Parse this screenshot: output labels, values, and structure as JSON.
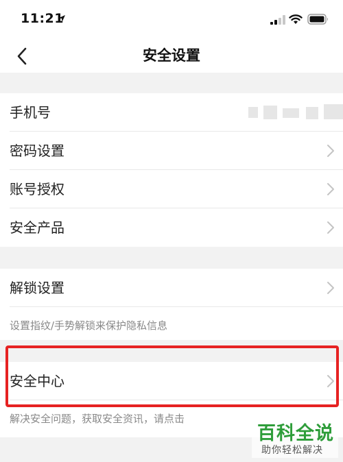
{
  "status_bar": {
    "time": "11:21"
  },
  "nav": {
    "title": "安全设置"
  },
  "groups": {
    "account": {
      "items": [
        {
          "label": "手机号"
        },
        {
          "label": "密码设置"
        },
        {
          "label": "账号授权"
        },
        {
          "label": "安全产品"
        }
      ]
    },
    "unlock": {
      "label": "解锁设置",
      "hint": "设置指纹/手势解锁来保护隐私信息"
    },
    "center": {
      "label": "安全中心",
      "hint": "解决安全问题，获取安全资讯，请点击"
    }
  },
  "watermark": {
    "title": "百科全说",
    "subtitle": "助你轻松解决"
  },
  "colors": {
    "highlight": "#e62222",
    "watermark": "#2e9d3a"
  },
  "icons": [
    "location-arrow-icon",
    "signal-icon",
    "wifi-icon",
    "battery-icon",
    "back-arrow-icon",
    "chevron-right-icon"
  ]
}
